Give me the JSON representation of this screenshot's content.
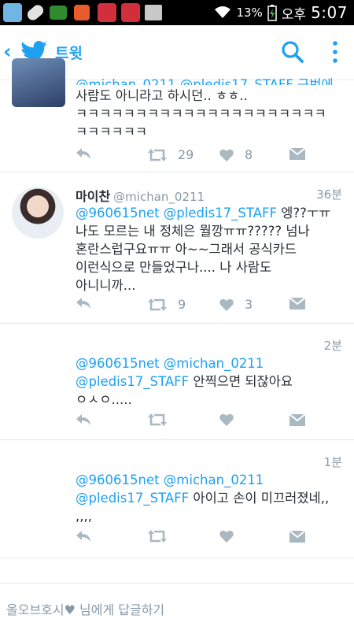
{
  "status_bar": {
    "battery": "13%",
    "carrier": "오후",
    "time": "5:07",
    "icons": [
      "g-app-icon",
      "pill-icon",
      "hd-icon",
      "fire-app-icon",
      "pin-app-icon",
      "pin-app-icon",
      "image-icon",
      "wifi-icon",
      "battery-charging-icon"
    ]
  },
  "app_bar": {
    "title": "트윗",
    "back_icon": "chevron-left-icon",
    "logo_icon": "twitter-bird-icon",
    "search_icon": "search-icon",
    "menu_icon": "overflow-menu-icon",
    "accent_color": "#1da1f2"
  },
  "tweets": [
    {
      "name": "",
      "handle": "",
      "time": "",
      "partial_top": "@michan_0211 @pledis17_STAFF 근번에",
      "text": "사람도 아니라고 하시던.. ㅎㅎ..\nㅋㅋㅋㅋㅋㅋㅋㅋㅋㅋㅋㅋㅋㅋㅋㅋㅋㅋㅋㅋㅋ\nㅋㅋㅋㅋㅋㅋ",
      "retweets": "29",
      "likes": "8"
    },
    {
      "name": "마이찬",
      "handle": "@michan_0211",
      "time": "36분",
      "mentions": "@960615net @pledis17_STAFF",
      "text": "엥??ㅜㅠ\n나도 모르는 내 정체은 뭘깡ㅠㅠ????? 넘나\n혼란스럽구요ㅠㅠ 아~~그래서 공식카드\n이런식으로 만들었구나.... 나 사람도\n아니니까...",
      "retweets": "9",
      "likes": "3"
    },
    {
      "name": "",
      "handle": "",
      "time": "2분",
      "mentions": "@960615net @michan_0211\n@pledis17_STAFF",
      "text": "안찍으면 되잖아요\nㅇㅅㅇ.....",
      "retweets": "",
      "likes": ""
    },
    {
      "name": "",
      "handle": "",
      "time": "1분",
      "mentions": "@960615net @michan_0211\n@pledis17_STAFF",
      "text": "아이고 손이 미끄러졌네,,\n,,,,",
      "retweets": "",
      "likes": ""
    }
  ],
  "reply_bar": {
    "placeholder": "올오브호시♥  님에게 답글하기"
  }
}
